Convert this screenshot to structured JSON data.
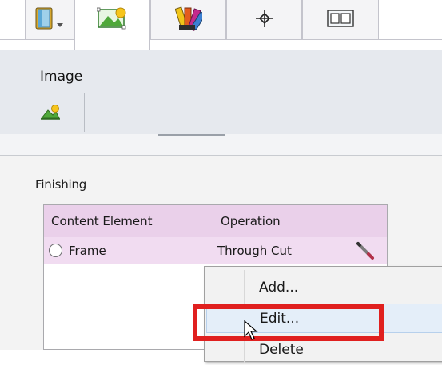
{
  "tabs": [
    {
      "id": "document",
      "icon": "notebook-dropdown-icon",
      "active": false
    },
    {
      "id": "image",
      "icon": "image-tab-icon",
      "active": true
    },
    {
      "id": "color",
      "icon": "color-swatch-icon",
      "active": false
    },
    {
      "id": "position",
      "icon": "crosshair-icon",
      "active": false
    },
    {
      "id": "layout",
      "icon": "layout-frame-icon",
      "active": false
    }
  ],
  "ribbon": {
    "title": "Image",
    "button_icon": "image-insert-icon"
  },
  "finishing": {
    "title": "Finishing",
    "columns": [
      "Content Element",
      "Operation"
    ],
    "rows": [
      {
        "element": "Frame",
        "operation": "Through Cut",
        "selected": false
      }
    ]
  },
  "context_menu": {
    "items": [
      {
        "label": "Add...",
        "highlighted": false
      },
      {
        "label": "Edit...",
        "highlighted": true
      },
      {
        "label": "Delete",
        "highlighted": false
      }
    ]
  },
  "colors": {
    "table_header": "#ead0ea",
    "table_row": "#f1dcf1",
    "highlight": "#e0201f",
    "menu_hover": "#e4eef9"
  }
}
